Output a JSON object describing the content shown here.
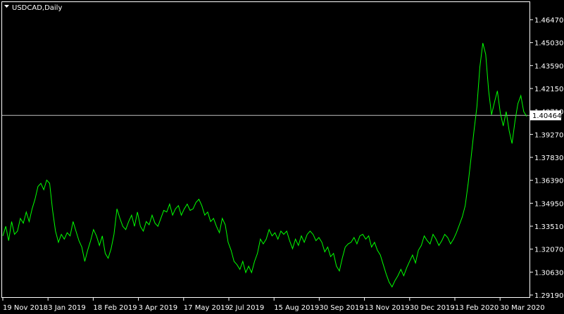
{
  "window": {
    "title": "USDCAD,Daily"
  },
  "colors": {
    "background": "#000000",
    "frame": "#ffffff",
    "series": "#00ff00",
    "bid_line": "#c0c0c0",
    "text": "#ffffff"
  },
  "icons": {
    "title_menu": "triangle-down-icon"
  },
  "current_price": {
    "label": "1.40464",
    "value": 1.40464
  },
  "chart_data": {
    "type": "line",
    "title": "USDCAD,Daily",
    "y_ticks": [
      1.4647,
      1.4503,
      1.4359,
      1.4215,
      1.4071,
      1.3927,
      1.3783,
      1.3639,
      1.3495,
      1.3351,
      1.3207,
      1.3063,
      1.2919
    ],
    "y_tick_labels": [
      "1.46470",
      "1.45030",
      "1.43590",
      "1.42150",
      "1.40710",
      "1.39270",
      "1.37830",
      "1.36390",
      "1.34950",
      "1.33510",
      "1.32070",
      "1.30630",
      "1.29190"
    ],
    "x_tick_labels": [
      "19 Nov 2018",
      "3 Jan 2019",
      "18 Feb 2019",
      "3 Apr 2019",
      "17 May 2019",
      "2 Jul 2019",
      "15 Aug 2019",
      "30 Sep 2019",
      "13 Nov 2019",
      "30 Dec 2019",
      "13 Feb 2020",
      "30 Mar 2020"
    ],
    "series": [
      {
        "values": [
          1.329,
          1.335,
          1.326,
          1.338,
          1.33,
          1.332,
          1.34,
          1.337,
          1.344,
          1.338,
          1.346,
          1.352,
          1.36,
          1.362,
          1.358,
          1.364,
          1.362,
          1.345,
          1.332,
          1.325,
          1.33,
          1.327,
          1.331,
          1.329,
          1.338,
          1.332,
          1.326,
          1.322,
          1.313,
          1.32,
          1.326,
          1.333,
          1.329,
          1.323,
          1.329,
          1.318,
          1.315,
          1.321,
          1.33,
          1.346,
          1.34,
          1.335,
          1.333,
          1.338,
          1.342,
          1.335,
          1.344,
          1.335,
          1.332,
          1.338,
          1.336,
          1.342,
          1.337,
          1.335,
          1.34,
          1.345,
          1.344,
          1.349,
          1.342,
          1.346,
          1.348,
          1.342,
          1.346,
          1.349,
          1.345,
          1.346,
          1.35,
          1.352,
          1.348,
          1.342,
          1.344,
          1.338,
          1.34,
          1.335,
          1.331,
          1.34,
          1.336,
          1.325,
          1.32,
          1.313,
          1.311,
          1.308,
          1.313,
          1.306,
          1.31,
          1.306,
          1.313,
          1.318,
          1.327,
          1.324,
          1.327,
          1.333,
          1.329,
          1.331,
          1.327,
          1.332,
          1.33,
          1.332,
          1.326,
          1.321,
          1.327,
          1.323,
          1.329,
          1.325,
          1.33,
          1.332,
          1.33,
          1.326,
          1.328,
          1.325,
          1.319,
          1.322,
          1.316,
          1.318,
          1.31,
          1.307,
          1.315,
          1.322,
          1.324,
          1.325,
          1.328,
          1.324,
          1.329,
          1.33,
          1.327,
          1.329,
          1.322,
          1.325,
          1.32,
          1.317,
          1.311,
          1.305,
          1.3,
          1.297,
          1.301,
          1.304,
          1.308,
          1.304,
          1.309,
          1.313,
          1.317,
          1.312,
          1.32,
          1.323,
          1.329,
          1.326,
          1.324,
          1.33,
          1.327,
          1.323,
          1.326,
          1.33,
          1.328,
          1.324,
          1.327,
          1.331,
          1.336,
          1.341,
          1.348,
          1.362,
          1.378,
          1.395,
          1.41,
          1.435,
          1.45,
          1.443,
          1.42,
          1.405,
          1.413,
          1.42,
          1.406,
          1.398,
          1.407,
          1.395,
          1.387,
          1.401,
          1.412,
          1.417,
          1.407,
          1.404
        ]
      }
    ],
    "grid": false,
    "legend": "none"
  }
}
